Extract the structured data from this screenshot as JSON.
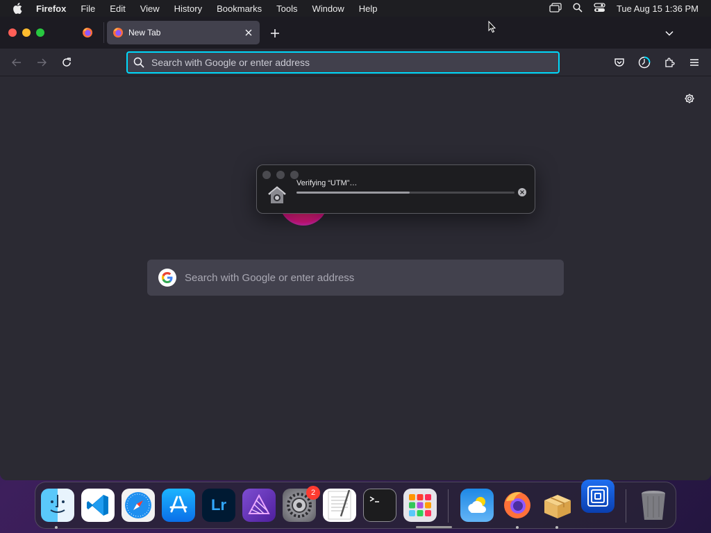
{
  "menubar": {
    "app_name": "Firefox",
    "items": [
      "File",
      "Edit",
      "View",
      "History",
      "Bookmarks",
      "Tools",
      "Window",
      "Help"
    ],
    "clock": "Tue Aug 15  1:36 PM"
  },
  "tabs": {
    "active_title": "New Tab"
  },
  "urlbar": {
    "placeholder": "Search with Google or enter address"
  },
  "newtab": {
    "search_placeholder": "Search with Google or enter address"
  },
  "dialog": {
    "title": "Verifying “UTM”…",
    "progress": 0.52
  },
  "dock": {
    "apps": [
      "Finder",
      "Visual Studio Code",
      "Safari",
      "App Store",
      "Lightroom",
      "Affinity Photo",
      "System Settings",
      "TextEdit",
      "Terminal",
      "Launchpad",
      "Weather",
      "Firefox",
      "Archive Utility",
      "UTM",
      "Trash"
    ],
    "lightroom_label": "Lr",
    "settings_badge": "2"
  },
  "colors": {
    "accent": "#00ddff",
    "window_bg": "#2b2a33",
    "tab_bg": "#42414d"
  }
}
